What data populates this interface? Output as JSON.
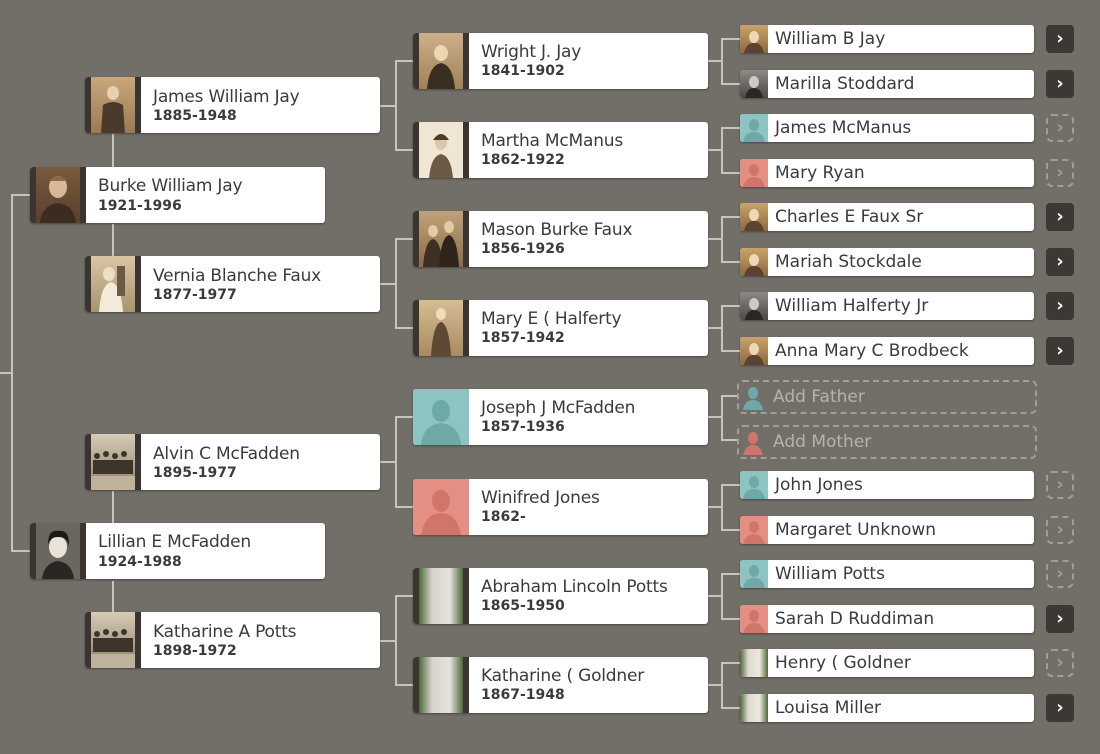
{
  "people": {
    "root": {
      "name": "Burke William Jay",
      "dates": "1921-1996"
    },
    "root_spouse": {
      "name": "Lillian E McFadden",
      "dates": "1924-1988"
    },
    "parent1": {
      "name": "James William Jay",
      "dates": "1885-1948"
    },
    "parent2": {
      "name": "Vernia Blanche Faux",
      "dates": "1877-1977"
    },
    "parent3": {
      "name": "Alvin C McFadden",
      "dates": "1895-1977"
    },
    "parent4": {
      "name": "Katharine A Potts",
      "dates": "1898-1972"
    },
    "gp1": {
      "name": "Wright J. Jay",
      "dates": "1841-1902"
    },
    "gp2": {
      "name": "Martha McManus",
      "dates": "1862-1922"
    },
    "gp3": {
      "name": "Mason Burke Faux",
      "dates": "1856-1926"
    },
    "gp4": {
      "name": "Mary E ( Halferty",
      "dates": "1857-1942"
    },
    "gp5": {
      "name": "Joseph J McFadden",
      "dates": "1857-1936"
    },
    "gp6": {
      "name": "Winifred Jones",
      "dates": "1862-"
    },
    "gp7": {
      "name": "Abraham Lincoln Potts",
      "dates": "1865-1950"
    },
    "gp8": {
      "name": "Katharine ( Goldner",
      "dates": "1867-1948"
    }
  },
  "ancestors": [
    {
      "name": "William B Jay",
      "arrow": "›",
      "photo": "photo-sepia"
    },
    {
      "name": "Marilla Stoddard",
      "arrow": "›",
      "photo": "photo-dark"
    },
    {
      "name": "James McManus",
      "arrow": "›",
      "photo": "male-placeholder"
    },
    {
      "name": "Mary Ryan",
      "arrow": "›",
      "photo": "female-placeholder"
    },
    {
      "name": "Charles E Faux Sr",
      "arrow": "›",
      "photo": "photo-sepia"
    },
    {
      "name": "Mariah Stockdale",
      "arrow": "›",
      "photo": "photo-sepia"
    },
    {
      "name": "William Halferty Jr",
      "arrow": "›",
      "photo": "photo-dark"
    },
    {
      "name": "Anna Mary C Brodbeck",
      "arrow": "›",
      "photo": "photo-sepia"
    },
    {
      "name": "Add Father",
      "arrow": "",
      "photo": "add-male"
    },
    {
      "name": "Add Mother",
      "arrow": "",
      "photo": "add-female"
    },
    {
      "name": "John Jones",
      "arrow": "›",
      "photo": "male-placeholder"
    },
    {
      "name": "Margaret Unknown",
      "arrow": "›",
      "photo": "female-placeholder"
    },
    {
      "name": "William Potts",
      "arrow": "›",
      "photo": "male-placeholder"
    },
    {
      "name": "Sarah D Ruddiman",
      "arrow": "›",
      "photo": "female-placeholder"
    },
    {
      "name": "Henry ( Goldner",
      "arrow": "›",
      "photo": "photo-grave"
    },
    {
      "name": "Louisa Miller",
      "arrow": "›",
      "photo": "photo-grave"
    }
  ],
  "colors": {
    "background": "#726e68",
    "male_placeholder": "#8dc3c1",
    "female_placeholder": "#e48f84",
    "arrow_bg": "#3c3834"
  }
}
